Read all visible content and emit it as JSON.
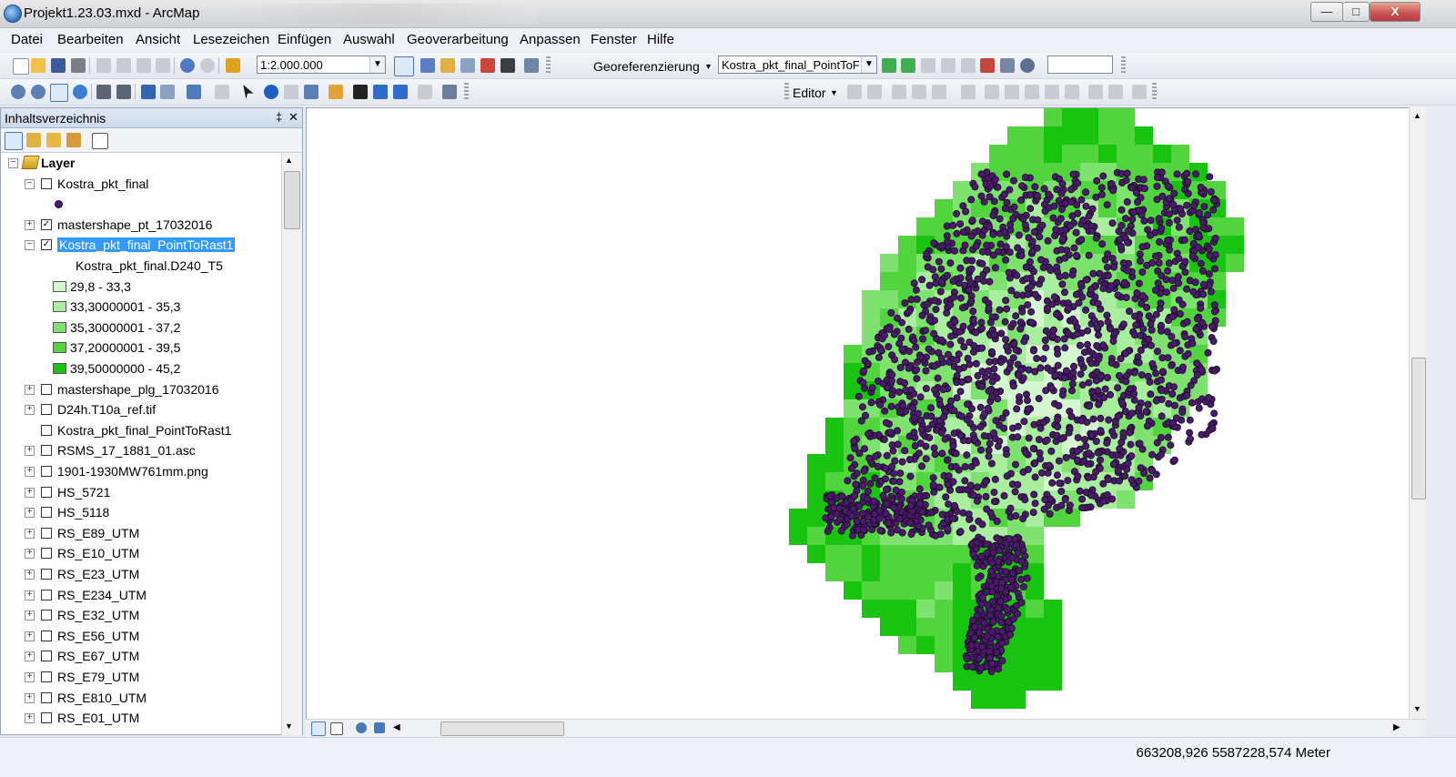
{
  "window": {
    "title": "Projekt1.23.03.mxd - ArcMap",
    "controls": {
      "minimize": "—",
      "maximize": "□",
      "close": "X"
    }
  },
  "menu": [
    "Datei",
    "Bearbeiten",
    "Ansicht",
    "Lesezeichen",
    "Einfügen",
    "Auswahl",
    "Geoverarbeitung",
    "Anpassen",
    "Fenster",
    "Hilfe"
  ],
  "toolbar": {
    "scale": "1:2.000.000",
    "georef_label": "Georeferenzierung",
    "georef_layer": "Kostra_pkt_final_PointToF",
    "georef_input": "",
    "editor_label": "Editor"
  },
  "toc": {
    "title": "Inhaltsverzeichnis",
    "pin": "‡",
    "close": "✕",
    "group": "Layer",
    "class_field": "Kostra_pkt_final.D240_T5",
    "layers": [
      {
        "name": "Kostra_pkt_final",
        "expand": "−",
        "checked": false
      },
      {
        "name": "mastershape_pt_17032016",
        "expand": "+",
        "checked": true
      },
      {
        "name": "Kostra_pkt_final_PointToRast1",
        "expand": "−",
        "checked": true,
        "selected": true
      },
      {
        "name": "mastershape_plg_17032016",
        "expand": "+",
        "checked": false
      },
      {
        "name": "D24h.T10a_ref.tif",
        "expand": "+",
        "checked": false
      },
      {
        "name": "Kostra_pkt_final_PointToRast1",
        "expand": "",
        "checked": false
      },
      {
        "name": "RSMS_17_1881_01.asc",
        "expand": "+",
        "checked": false
      },
      {
        "name": "1901-1930MW761mm.png",
        "expand": "+",
        "checked": false
      },
      {
        "name": "HS_5721",
        "expand": "+",
        "checked": false
      },
      {
        "name": "HS_5118",
        "expand": "+",
        "checked": false
      },
      {
        "name": "RS_E89_UTM",
        "expand": "+",
        "checked": false
      },
      {
        "name": "RS_E10_UTM",
        "expand": "+",
        "checked": false
      },
      {
        "name": "RS_E23_UTM",
        "expand": "+",
        "checked": false
      },
      {
        "name": "RS_E234_UTM",
        "expand": "+",
        "checked": false
      },
      {
        "name": "RS_E32_UTM",
        "expand": "+",
        "checked": false
      },
      {
        "name": "RS_E56_UTM",
        "expand": "+",
        "checked": false
      },
      {
        "name": "RS_E67_UTM",
        "expand": "+",
        "checked": false
      },
      {
        "name": "RS_E79_UTM",
        "expand": "+",
        "checked": false
      },
      {
        "name": "RS_E810_UTM",
        "expand": "+",
        "checked": false
      },
      {
        "name": "RS_E01_UTM",
        "expand": "+",
        "checked": false
      }
    ],
    "classes": [
      {
        "label": "29,8 - 33,3",
        "color": "#d4f7cf"
      },
      {
        "label": "33,30000001 - 35,3",
        "color": "#a9ee9e"
      },
      {
        "label": "35,30000001 - 37,2",
        "color": "#7ee26e"
      },
      {
        "label": "37,20000001 - 39,5",
        "color": "#52d43f"
      },
      {
        "label": "39,50000000 - 45,2",
        "color": "#18c40f"
      }
    ]
  },
  "map": {
    "raster_colors": [
      "#d4f7cf",
      "#a9ee9e",
      "#7ee26e",
      "#52d43f",
      "#18c40f"
    ],
    "point_color": "#4a1a6b",
    "point_outline": "#1a0a24"
  },
  "status": {
    "coordinates": "663208,926  5587228,574 Meter"
  }
}
